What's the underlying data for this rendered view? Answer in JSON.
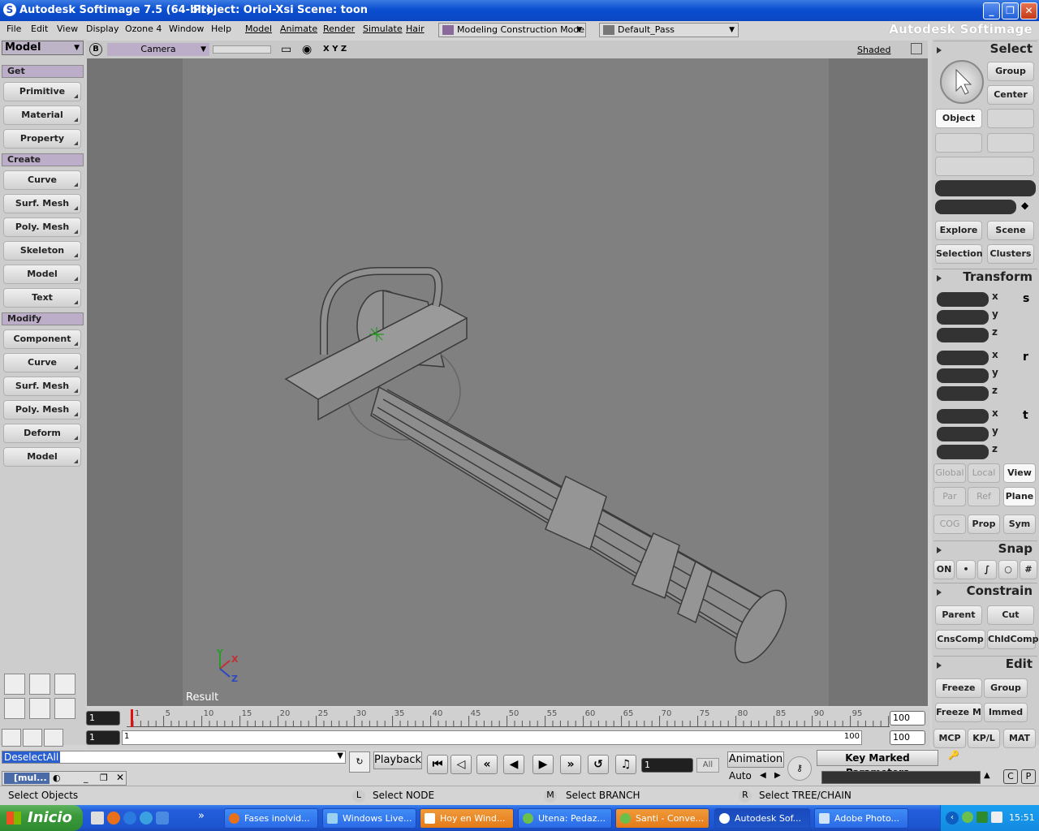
{
  "window": {
    "title": "Autodesk Softimage 7.5 (64-bit)",
    "project": "Project: Oriol-Xsi",
    "scene": "Scene: toon",
    "brand": "Autodesk Softimage"
  },
  "menus": [
    "File",
    "Edit",
    "View",
    "Display",
    "Ozone 4",
    "Window",
    "Help",
    "Model",
    "Animate",
    "Render",
    "Simulate",
    "Hair"
  ],
  "construction_mode": "Modeling Construction Mode",
  "pass": "Default_Pass",
  "left": {
    "mode": "Model",
    "sections": [
      {
        "title": "Get",
        "items": [
          "Primitive",
          "Material",
          "Property"
        ]
      },
      {
        "title": "Create",
        "items": [
          "Curve",
          "Surf. Mesh",
          "Poly. Mesh",
          "Skeleton",
          "Model",
          "Text"
        ]
      },
      {
        "title": "Modify",
        "items": [
          "Component",
          "Curve",
          "Surf. Mesh",
          "Poly. Mesh",
          "Deform",
          "Model"
        ]
      }
    ]
  },
  "viewport": {
    "letter": "B",
    "camera": "Camera",
    "axes": "X Y Z",
    "shading": "Shaded",
    "result_label": "Result",
    "gizmo": {
      "x": "X",
      "y": "Y",
      "z": "Z"
    }
  },
  "timeline": {
    "ticks": [
      "1",
      "5",
      "10",
      "15",
      "20",
      "25",
      "30",
      "35",
      "40",
      "45",
      "50",
      "55",
      "60",
      "65",
      "70",
      "75",
      "80",
      "85",
      "90",
      "95"
    ],
    "current_frame": "1",
    "start": "1",
    "end": "100",
    "range_start": "1",
    "range_end": "100",
    "range_end2": "100"
  },
  "playback": {
    "command": "DeselectAll",
    "playback_label": "Playback",
    "frame": "1",
    "all_label": "All",
    "animation_label": "Animation",
    "auto_label": "Auto",
    "key_marked": "Key Marked Parameters",
    "mini_tab": "[mul..."
  },
  "status": {
    "left": "Select Objects",
    "l_key": "L",
    "l_text": "Select NODE",
    "m_key": "M",
    "m_text": "Select BRANCH",
    "r_key": "R",
    "r_text": "Select TREE/CHAIN"
  },
  "right": {
    "select_title": "Select",
    "group": "Group",
    "center": "Center",
    "object": "Object",
    "explore": "Explore",
    "scene": "Scene",
    "selection": "Selection",
    "clusters": "Clusters",
    "transform_title": "Transform",
    "axes": [
      "x",
      "y",
      "z"
    ],
    "srt": [
      "s",
      "r",
      "t"
    ],
    "global": "Global",
    "local": "Local",
    "view": "View",
    "par": "Par",
    "ref": "Ref",
    "plane": "Plane",
    "cog": "COG",
    "prop": "Prop",
    "sym": "Sym",
    "snap_title": "Snap",
    "on": "ON",
    "constrain_title": "Constrain",
    "parent": "Parent",
    "cut": "Cut",
    "cnscomp": "CnsComp",
    "chldcomp": "ChldComp",
    "edit_title": "Edit",
    "freeze": "Freeze",
    "group2": "Group",
    "freezem": "Freeze M",
    "immed": "Immed",
    "mcp": "MCP",
    "kpl": "KP/L",
    "mat": "MAT"
  },
  "taskbar": {
    "start": "Inicio",
    "tasks": [
      "Fases inolvid...",
      "Windows Live...",
      "Hoy en Wind...",
      "Utena: Pedaz...",
      "Santi - Conve...",
      "Autodesk Sof...",
      "Adobe Photo..."
    ],
    "clock": "15:51"
  },
  "colors": {
    "title_blue": "#0b4fd0",
    "section_purple": "#bcaec9",
    "viewport_gray": "#808080",
    "taskbar_blue": "#245edb",
    "start_green": "#3a9a3a"
  }
}
